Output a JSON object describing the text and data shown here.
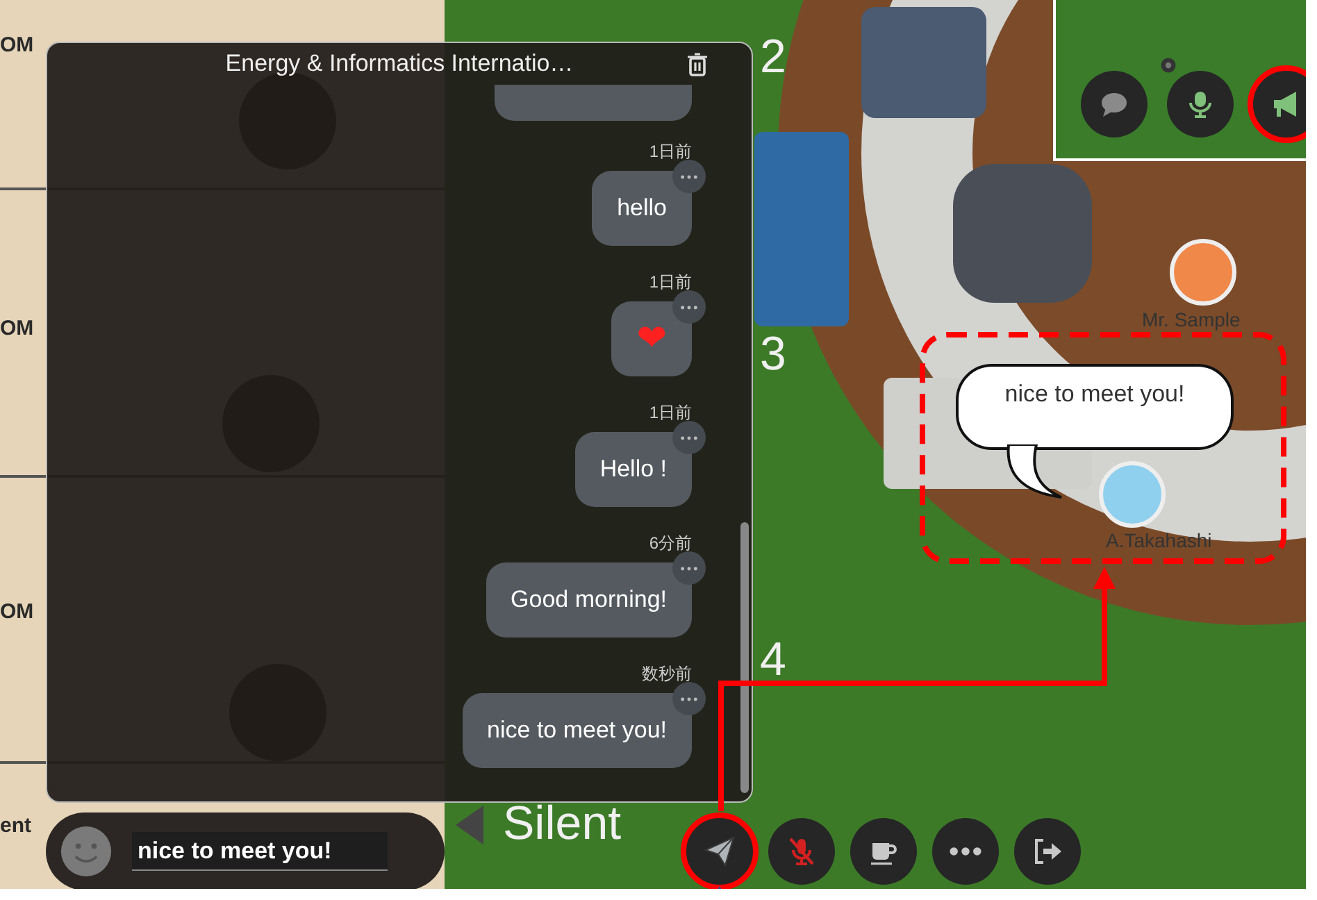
{
  "map": {
    "room_labels": [
      {
        "text": "OM"
      },
      {
        "text": "OM"
      },
      {
        "text": "OM"
      },
      {
        "text": "ent"
      }
    ],
    "room_titles": [
      "2",
      "3",
      "4",
      "Silent"
    ],
    "avatars": [
      {
        "name": "Mr. Sample",
        "color": "#f0884a"
      },
      {
        "name": "A.Takahashi",
        "color": "#8fd0ee",
        "speech": "nice to meet you!"
      }
    ]
  },
  "chat": {
    "title": "Energy & Informatics Internatio…",
    "messages": [
      {
        "time": "1日前",
        "text": "hello",
        "kind": "text"
      },
      {
        "time": "1日前",
        "text": "❤",
        "kind": "emoji"
      },
      {
        "time": "1日前",
        "text": "Hello !",
        "kind": "text"
      },
      {
        "time": "6分前",
        "text": "Good morning!",
        "kind": "text"
      },
      {
        "time": "数秒前",
        "text": "nice to meet you!",
        "kind": "text"
      }
    ],
    "input": {
      "value": "nice to meet you!"
    }
  },
  "toolbar": [
    {
      "kind": "send",
      "highlighted": true
    },
    {
      "kind": "mic-off",
      "highlighted": false
    },
    {
      "kind": "coffee",
      "highlighted": false
    },
    {
      "kind": "more",
      "highlighted": false
    },
    {
      "kind": "exit",
      "highlighted": false
    }
  ],
  "inset": {
    "buttons": [
      {
        "kind": "chat",
        "highlighted": false
      },
      {
        "kind": "mic",
        "highlighted": false
      },
      {
        "kind": "megaphone",
        "highlighted": true
      }
    ]
  }
}
